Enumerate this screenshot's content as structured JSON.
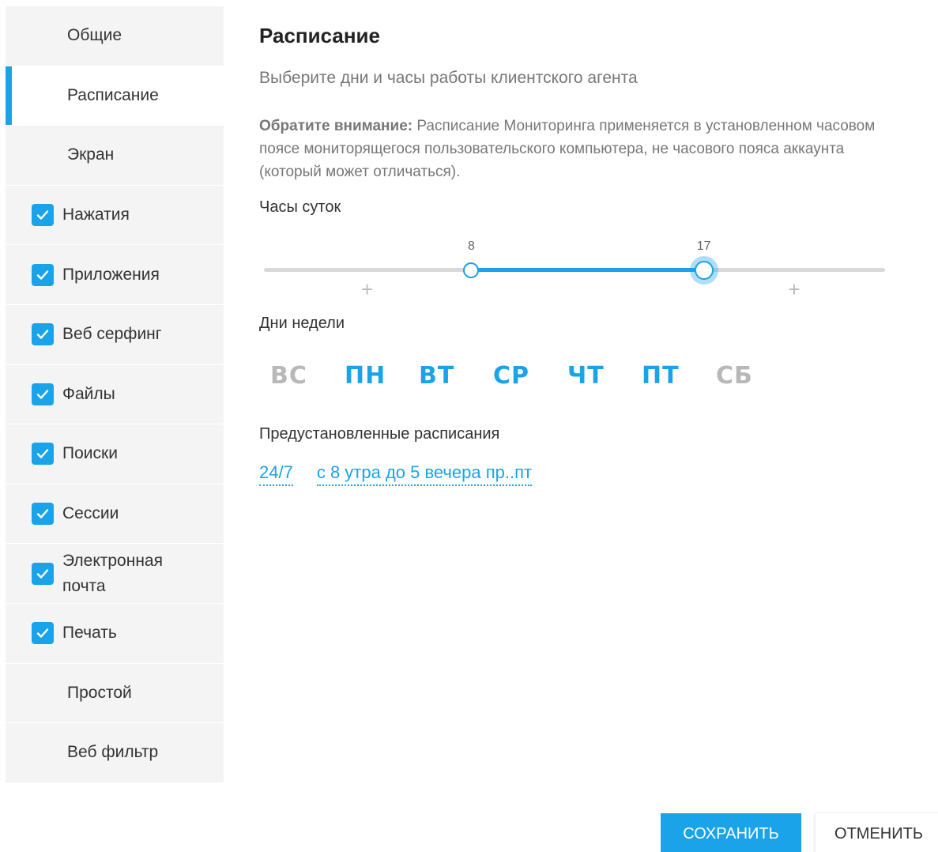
{
  "sidebar": {
    "items": [
      {
        "label": "Общие",
        "checked": false
      },
      {
        "label": "Расписание",
        "checked": false,
        "active": true
      },
      {
        "label": "Экран",
        "checked": false
      },
      {
        "label": "Нажатия",
        "checked": true
      },
      {
        "label": "Приложения",
        "checked": true
      },
      {
        "label": "Веб серфинг",
        "checked": true
      },
      {
        "label": "Файлы",
        "checked": true
      },
      {
        "label": "Поиски",
        "checked": true
      },
      {
        "label": "Сессии",
        "checked": true
      },
      {
        "label": "Электронная почта",
        "checked": true
      },
      {
        "label": "Печать",
        "checked": true
      },
      {
        "label": "Простой",
        "checked": false
      },
      {
        "label": "Веб фильтр",
        "checked": false
      }
    ]
  },
  "main": {
    "title": "Расписание",
    "subtitle": "Выберите дни и часы работы клиентского агента",
    "note_bold": "Обратите внимание:",
    "note_text": " Расписание Мониторинга применяется в установленном часовом поясе мониторящегося пользовательского компьютера, не часового пояса аккаунта (который может отличаться).",
    "hours_label": "Часы суток",
    "hours": {
      "min": 0,
      "max": 24,
      "start": 8,
      "end": 17,
      "start_label": "8",
      "end_label": "17",
      "plus": "+"
    },
    "days_label": "Дни недели",
    "days": [
      {
        "label": "ВС",
        "on": false
      },
      {
        "label": "ПН",
        "on": true
      },
      {
        "label": "ВТ",
        "on": true
      },
      {
        "label": "СР",
        "on": true
      },
      {
        "label": "ЧТ",
        "on": true
      },
      {
        "label": "ПТ",
        "on": true
      },
      {
        "label": "СБ",
        "on": false
      }
    ],
    "presets_label": "Предустановленные расписания",
    "presets": [
      "24/7",
      "с 8 утра до 5 вечера пр..пт"
    ]
  },
  "buttons": {
    "save": "СОХРАНИТЬ",
    "cancel": "ОТМЕНИТЬ"
  },
  "colors": {
    "accent": "#1aa3e8",
    "inactive_day": "#b8b8b8"
  }
}
